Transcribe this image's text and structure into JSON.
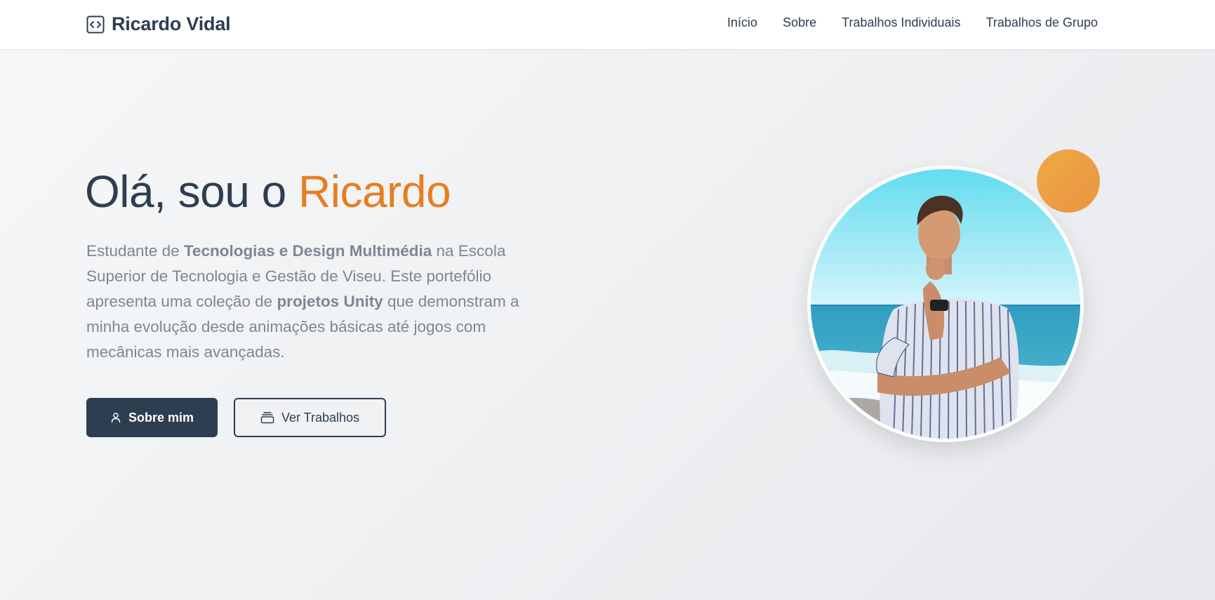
{
  "header": {
    "brand_name": "Ricardo Vidal",
    "brand_icon": "code-icon",
    "nav": [
      {
        "label": "Início"
      },
      {
        "label": "Sobre"
      },
      {
        "label": "Trabalhos Individuais"
      },
      {
        "label": "Trabalhos de Grupo"
      }
    ]
  },
  "hero": {
    "title_prefix": "Olá, sou o ",
    "title_name": "Ricardo",
    "desc_part1": "Estudante de ",
    "desc_bold1": "Tecnologias e Design Multimédia",
    "desc_part2": " na Escola Superior de Tecnologia e Gestão de Viseu. Este portefólio apresenta uma coleção de ",
    "desc_bold2": "projetos Unity",
    "desc_part3": " que demonstram a minha evolução desde animações básicas até jogos com mecânicas mais avançadas.",
    "primary_button": {
      "label": "Sobre mim",
      "icon": "user-icon"
    },
    "secondary_button": {
      "label": "Ver Trabalhos",
      "icon": "layers-icon"
    }
  },
  "colors": {
    "primary": "#2d3e50",
    "accent": "#e67e22",
    "deco": "#eea042",
    "text_muted": "#7d8793"
  }
}
